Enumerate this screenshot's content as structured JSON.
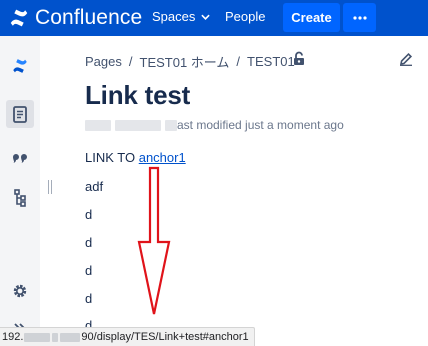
{
  "topbar": {
    "logo_text": "Confluence",
    "spaces_label": "Spaces",
    "people_label": "People",
    "create_label": "Create",
    "brand_color": "#0052cc",
    "button_color": "#0065ff"
  },
  "sidebar": {
    "items": [
      {
        "icon": "confluence-logo-icon"
      },
      {
        "icon": "page-icon",
        "active": true
      },
      {
        "icon": "quote-icon"
      },
      {
        "icon": "page-tree-icon"
      },
      {
        "icon": "settings-icon"
      },
      {
        "icon": "expand-sidebar-icon"
      }
    ]
  },
  "breadcrumb": {
    "items": [
      "Pages",
      "TEST01 ホーム",
      "TEST01"
    ],
    "separator": "/"
  },
  "page": {
    "title": "Link test",
    "byline_suffix": "ast modified just a moment ago",
    "link_prefix": "LINK TO ",
    "link_text": "anchor1",
    "lines": [
      "adf",
      "d",
      "d",
      "d",
      "d",
      "d"
    ]
  },
  "statusbar": {
    "url_start": "192.",
    "url_end": "90/display/TES/Link+test#anchor1"
  },
  "annotation": {
    "arrow_color": "#e0131a"
  }
}
